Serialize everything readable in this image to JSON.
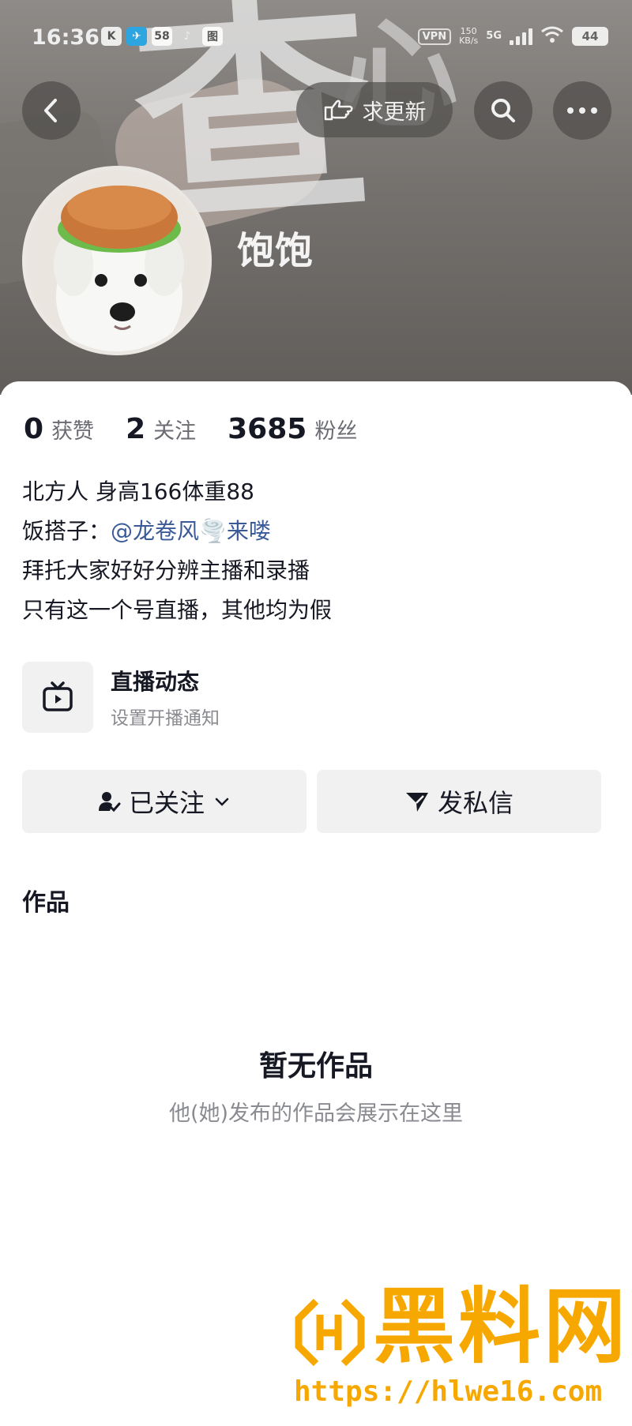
{
  "status_bar": {
    "time": "16:36",
    "apps": [
      "K",
      "✈",
      "58",
      "♪",
      "图"
    ],
    "vpn": "VPN",
    "speed_value": "150",
    "speed_unit": "KB/s",
    "network": "5G",
    "battery": "44"
  },
  "nav": {
    "update_label": "求更新"
  },
  "profile": {
    "nickname": "饱饱"
  },
  "stats": [
    {
      "value": "0",
      "label": "获赞"
    },
    {
      "value": "2",
      "label": "关注"
    },
    {
      "value": "3685",
      "label": "粉丝"
    }
  ],
  "bio": {
    "line1": "北方人 身高166体重88",
    "line2_prefix": "饭搭子：",
    "line2_mention": "@龙卷风🌪️来喽",
    "line3": "拜托大家好好分辨主播和录播",
    "line4": "只有这一个号直播，其他均为假"
  },
  "live": {
    "title": "直播动态",
    "subtitle": "设置开播通知"
  },
  "actions": {
    "follow_label": "已关注",
    "message_label": "发私信"
  },
  "tabs": {
    "works": "作品"
  },
  "empty": {
    "title": "暂无作品",
    "subtitle": "他(她)发布的作品会展示在这里"
  },
  "watermark": {
    "brand": "黑料网",
    "url": "https://hlwe16.com"
  },
  "colors": {
    "mention": "#3b5a9a",
    "watermark": "#f7a800"
  }
}
